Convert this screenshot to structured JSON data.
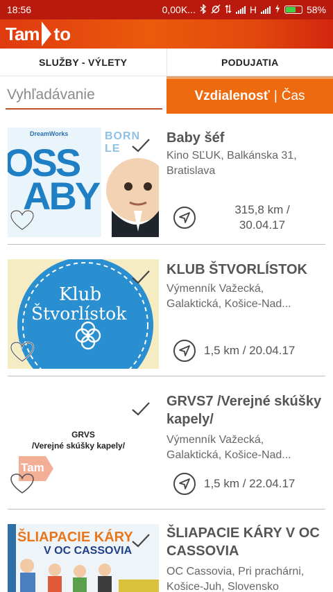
{
  "status": {
    "time": "18:56",
    "network": "0,00K...",
    "net_type": "H",
    "battery": "58%"
  },
  "app": {
    "logo_left": "Tam",
    "logo_right": "to"
  },
  "tabs": [
    {
      "label": "SLUŽBY - VÝLETY"
    },
    {
      "label": "PODUJATIA"
    }
  ],
  "search": {
    "placeholder": "Vyhľadávanie"
  },
  "sort": {
    "active": "Vzdialenosť",
    "separator": "|",
    "other": "Čas"
  },
  "events": [
    {
      "title": "Baby šéf",
      "place": "Kino SĽUK, Balkánska 31, Bratislava",
      "distance_line1": "315,8 km /",
      "distance_line2": "30.04.17",
      "thumb_text_a": "OSS",
      "thumb_text_b": "ABY",
      "thumb_brand": "DreamWorks",
      "thumb_tag": "BORN LE"
    },
    {
      "title": "KLUB ŠTVORLÍSTOK",
      "place_line1": "Výmenník Važecká,",
      "place_line2": "Galaktická, Košice-Nad...",
      "distance": "1,5 km / 20.04.17",
      "thumb_line1": "Klub",
      "thumb_line2": "Štvorlístok"
    },
    {
      "title": "GRVS7 /Verejné skúšky kapely/",
      "place_line1": "Výmenník Važecká,",
      "place_line2": "Galaktická, Košice-Nad...",
      "distance": "1,5 km / 22.04.17",
      "thumb_line1": "GRVS",
      "thumb_line2": "/Verejné skúšky kapely/",
      "thumb_logo": "Tam"
    },
    {
      "title": "ŠLIAPACIE KÁRY V OC CASSOVIA",
      "place": "OC Cassovia, Pri prachárni, Košice-Juh, Slovensko",
      "thumb_line1": "ŠLIAPACIE KÁRY",
      "thumb_line2": "V OC CASSOVIA"
    }
  ],
  "colors": {
    "status_bar": "#b81b0e",
    "app_bar_gradient": [
      "#e03a10",
      "#ea5a0c",
      "#d2260f"
    ],
    "sort_active": "#ef6a0f",
    "search_underline": "#c0502a"
  }
}
